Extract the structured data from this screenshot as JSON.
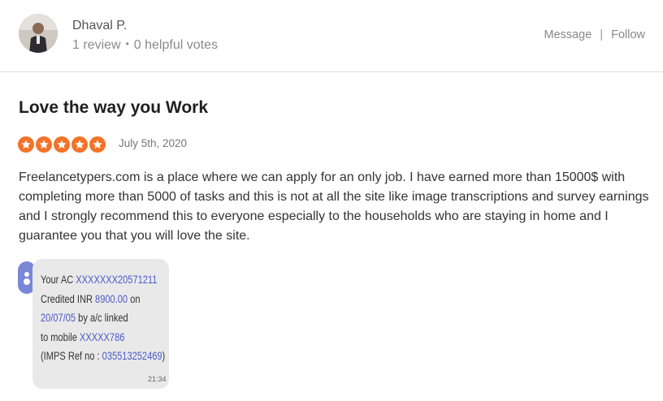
{
  "reviewer": {
    "name": "Dhaval P.",
    "review_count": "1 review",
    "separator": "•",
    "helpful_votes": "0 helpful votes"
  },
  "actions": {
    "message_label": "Message",
    "separator": "|",
    "follow_label": "Follow"
  },
  "review": {
    "title": "Love the way you Work",
    "rating": 5,
    "rating_max": 5,
    "star_color": "#f27328",
    "date": "July 5th, 2020",
    "body": "Freelancetypers.com is a place where we can apply for an only job. I have earned more than 15000$ with completing more than 5000 of tasks and this is not at all the site like image transcriptions and survey earnings and I strongly recommend this to everyone especially to the households who are staying in home and I guarantee you that you will love the site."
  },
  "sms": {
    "line1_prefix": "Your AC ",
    "account": "XXXXXXX20571211",
    "line2_prefix": "Credited INR ",
    "amount": "8900.00",
    "line2_suffix": " on",
    "date": "20/07/05",
    "line3_suffix": " by a/c linked",
    "line4_prefix": "to mobile ",
    "mobile": "XXXXX786",
    "line5_prefix": "(IMPS Ref no : ",
    "ref": "035513252469",
    "line5_suffix": ")",
    "time": "21:34",
    "link_color": "#4a5bc8"
  }
}
